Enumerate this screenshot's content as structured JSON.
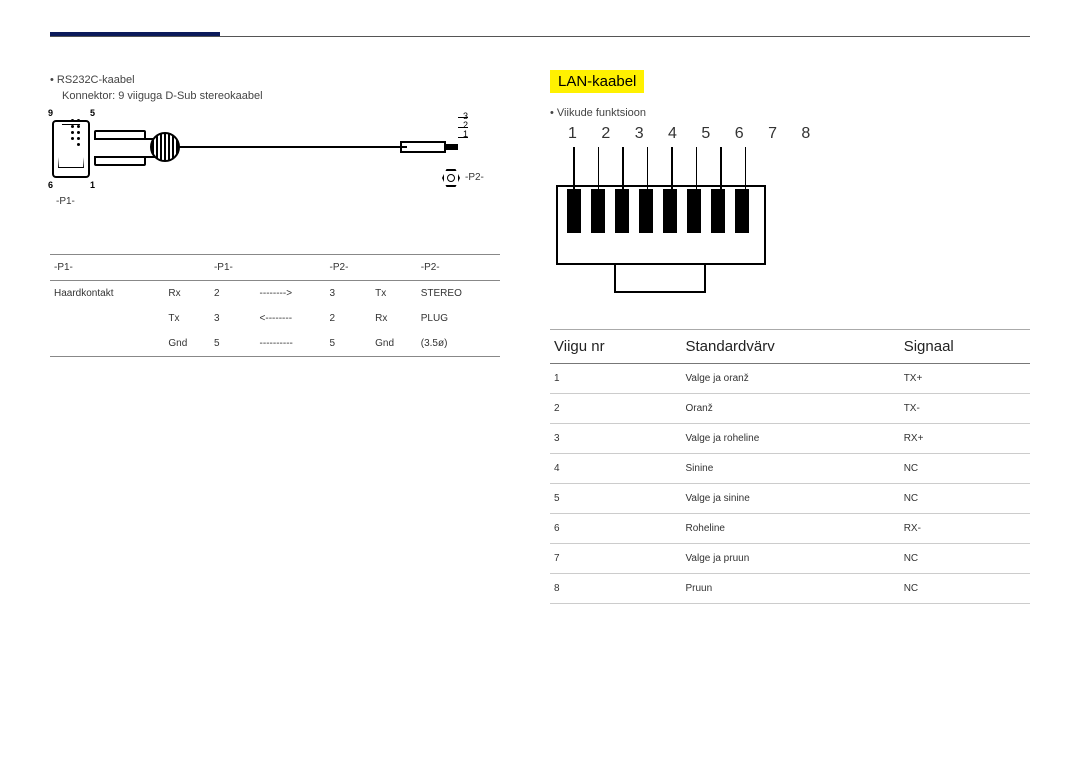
{
  "left": {
    "bullet": "RS232C-kaabel",
    "subline": "Konnektor: 9 viiguga D-Sub stereokaabel",
    "diagram": {
      "pin9": "9",
      "pin5": "5",
      "pin6": "6",
      "pin1": "1",
      "p1": "-P1-",
      "p2": "-P2-",
      "plug1": "3",
      "plug2": "2",
      "plug3": "1"
    },
    "pin_header": {
      "c0": "-P1-",
      "c1": "-P1-",
      "c2": "-P2-",
      "c3": "-P2-"
    },
    "pin_rows": [
      {
        "a": "Haardkontakt",
        "b": "Rx",
        "c": "2",
        "d": "-------->",
        "e": "3",
        "f": "Tx",
        "g": "STEREO"
      },
      {
        "a": "",
        "b": "Tx",
        "c": "3",
        "d": "<--------",
        "e": "2",
        "f": "Rx",
        "g": "PLUG"
      },
      {
        "a": "",
        "b": "Gnd",
        "c": "5",
        "d": "----------",
        "e": "5",
        "f": "Gnd",
        "g": "(3.5ø)"
      }
    ]
  },
  "right": {
    "heading": "LAN-kaabel",
    "bullet": "Viikude funktsioon",
    "rj45_nums": "1 2 3 4 5 6 7 8",
    "lan_headers": {
      "c0": "Viigu nr",
      "c1": "Standardvärv",
      "c2": "Signaal"
    },
    "lan_rows": [
      {
        "n": "1",
        "color": "Valge ja oranž",
        "sig": "TX+"
      },
      {
        "n": "2",
        "color": "Oranž",
        "sig": "TX-"
      },
      {
        "n": "3",
        "color": "Valge ja roheline",
        "sig": "RX+"
      },
      {
        "n": "4",
        "color": "Sinine",
        "sig": "NC"
      },
      {
        "n": "5",
        "color": "Valge ja sinine",
        "sig": "NC"
      },
      {
        "n": "6",
        "color": "Roheline",
        "sig": "RX-"
      },
      {
        "n": "7",
        "color": "Valge ja pruun",
        "sig": "NC"
      },
      {
        "n": "8",
        "color": "Pruun",
        "sig": "NC"
      }
    ]
  }
}
